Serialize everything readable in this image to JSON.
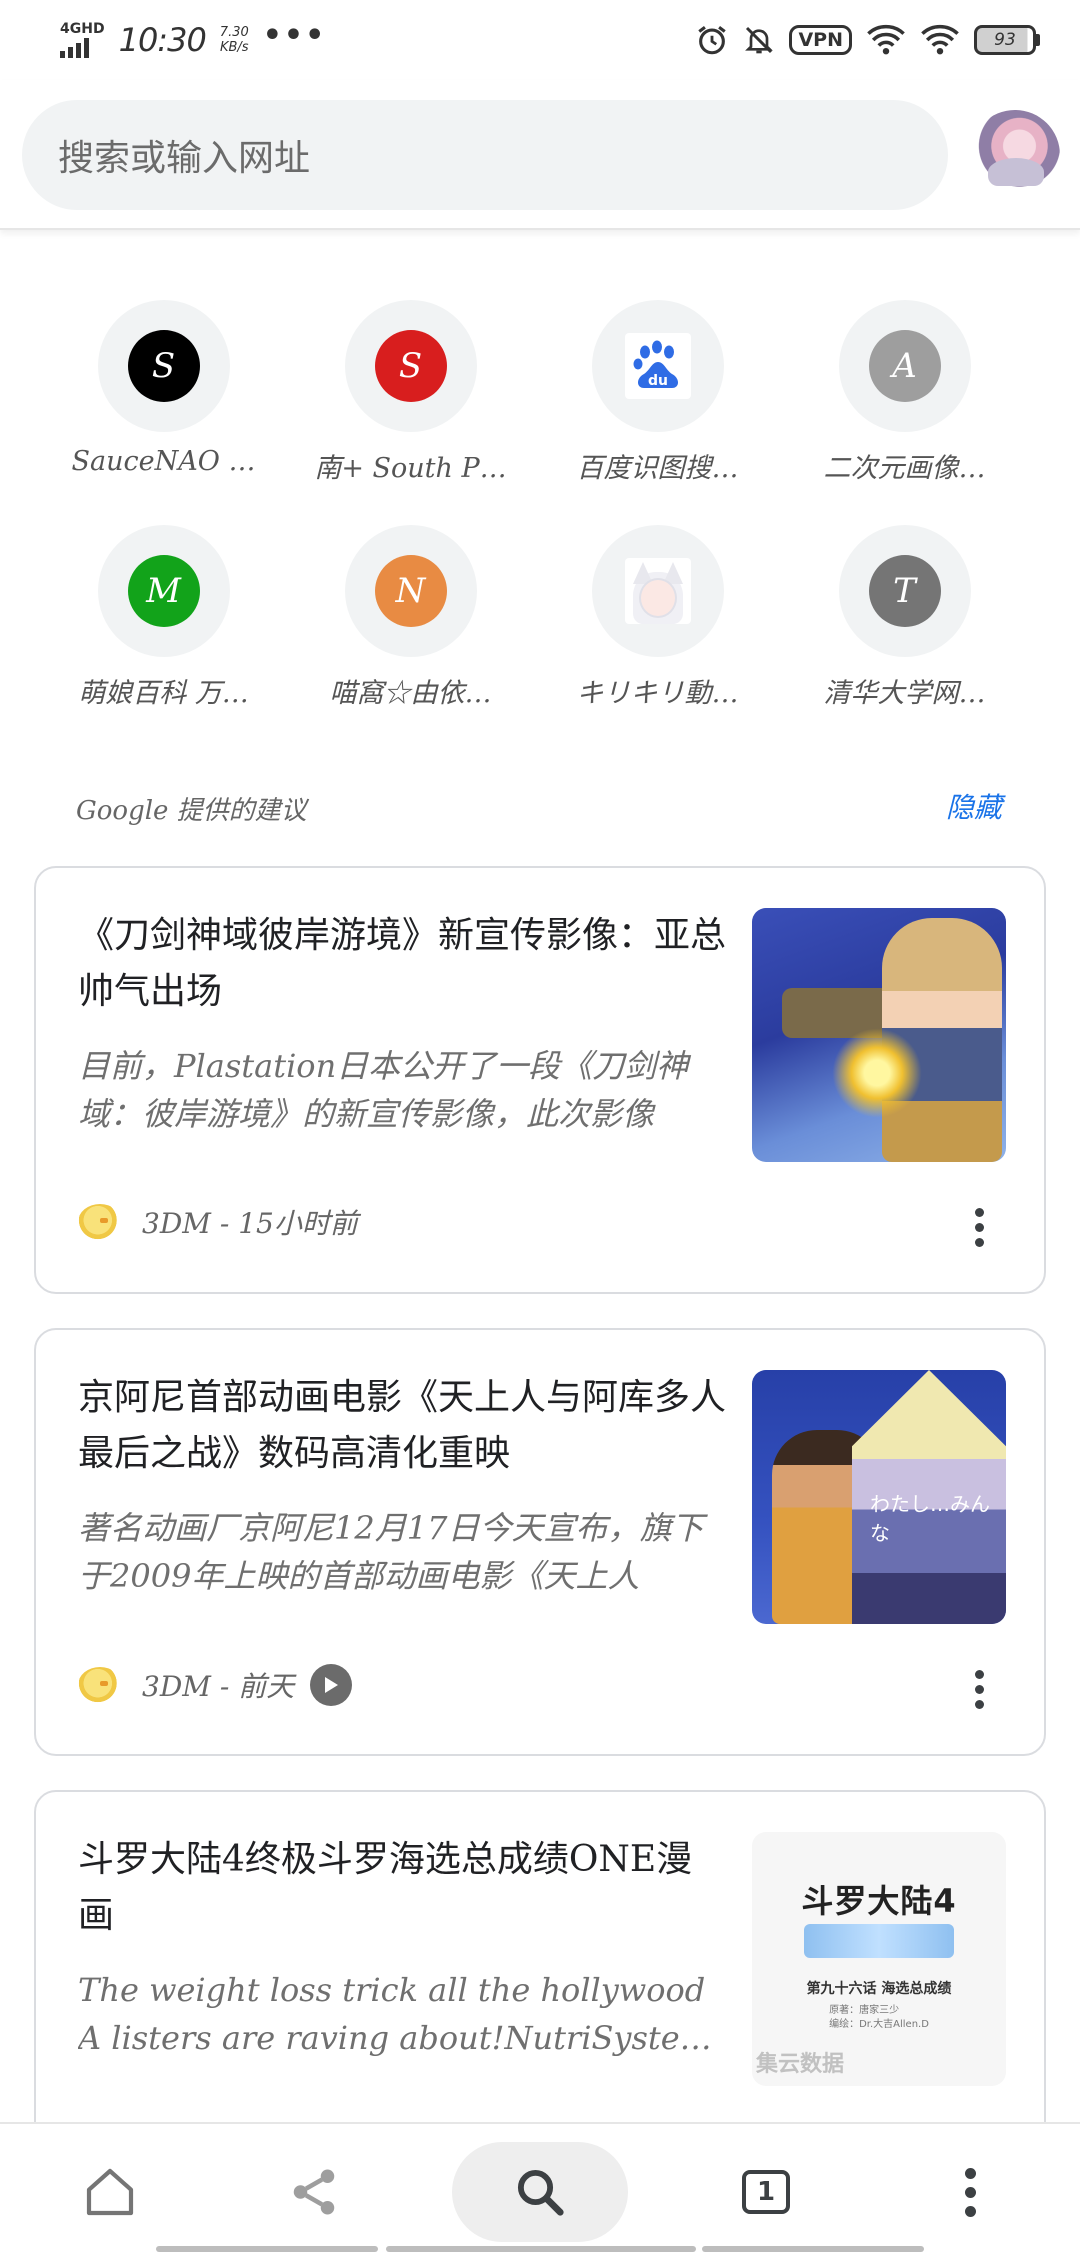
{
  "status_bar": {
    "network": "4GHD",
    "time": "10:30",
    "speed_value": "7.30",
    "speed_unit": "KB/s",
    "overflow": "•••",
    "vpn": "VPN",
    "battery": "93"
  },
  "search": {
    "placeholder": "搜索或输入网址"
  },
  "shortcuts": [
    {
      "label": "SauceNAO …",
      "letter": "S",
      "color": "#000000"
    },
    {
      "label": "南+ South P…",
      "letter": "S",
      "color": "#d81e1e"
    },
    {
      "label": "百度识图搜…",
      "icon": "baidu-icon",
      "color": "#2f6ce5"
    },
    {
      "label": "二次元画像…",
      "letter": "A",
      "color": "#9e9e9e"
    },
    {
      "label": "萌娘百科 万…",
      "letter": "M",
      "color": "#12a31a"
    },
    {
      "label": "喵窩☆由依…",
      "letter": "N",
      "color": "#e88b43"
    },
    {
      "label": "キリキリ動…",
      "icon": "fox-girl-icon"
    },
    {
      "label": "清华大学网…",
      "letter": "T",
      "color": "#757575"
    }
  ],
  "suggestions": {
    "title": "Google 提供的建议",
    "hide_label": "隐藏"
  },
  "cards": [
    {
      "title": "《刀剑神域彼岸游境》新宣传影像：亚总帅气出场",
      "snippet": "目前，Plastation日本公开了一段《刀剑神域：彼岸游境》的新宣传影像，此次影像",
      "source": "3DM - 15小时前"
    },
    {
      "title": "京阿尼首部动画电影《天上人与阿库多人最后之战》数码高清化重映",
      "snippet": "著名动画厂京阿尼12月17日今天宣布，旗下于2009年上映的首部动画电影《天上人",
      "source": "3DM - 前天",
      "thumb_text": "わたし…みんな"
    },
    {
      "title": "斗罗大陆4终极斗罗海选总成绩ONE漫画",
      "snippet": "The weight loss trick all the hollywood A listers are raving about!NutriSystem • 赞助",
      "thumb_logo": "斗罗大陆4",
      "thumb_chapter": "第九十六话  海选总成绩",
      "thumb_credits": "原著：唐家三少\n编绘：Dr.大吉Allen.D",
      "thumb_watermark": "集云数据"
    }
  ],
  "bottom_nav": {
    "tab_count": "1"
  },
  "colors": {
    "accent": "#1a73e8",
    "surface": "#f1f3f4",
    "border": "#dadce0"
  }
}
